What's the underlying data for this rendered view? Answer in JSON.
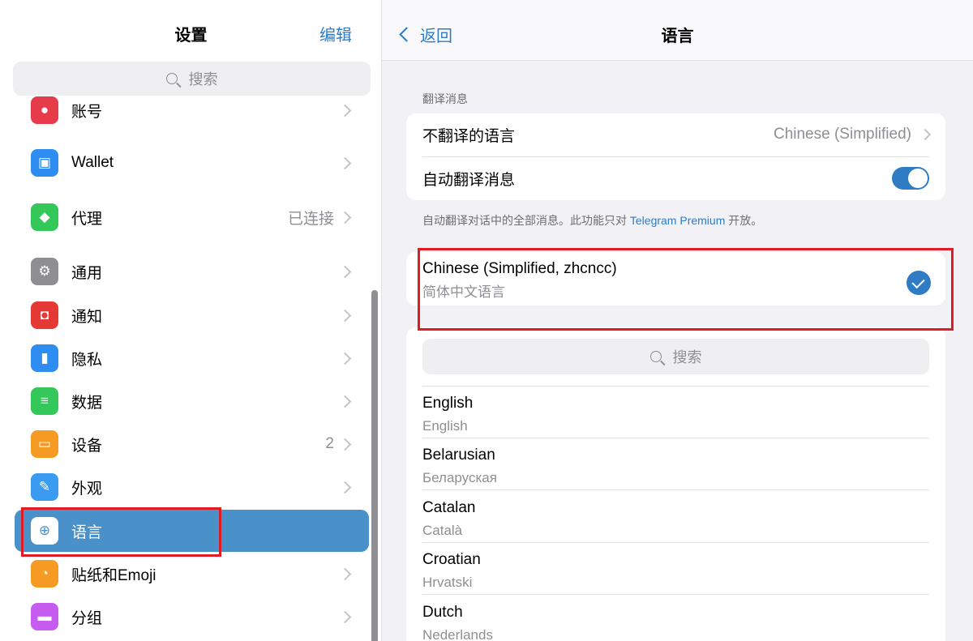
{
  "sidebar": {
    "title": "设置",
    "edit_label": "编辑",
    "search_placeholder": "搜索",
    "items": [
      {
        "label": "账号",
        "value": "",
        "icon": "account-icon",
        "color": "#e53b4a"
      },
      {
        "label": "Wallet",
        "value": "",
        "icon": "wallet-icon",
        "color": "#2f8cf0"
      },
      {
        "label": "代理",
        "value": "已连接",
        "icon": "shield-icon",
        "color": "#34c759"
      },
      {
        "label": "通用",
        "value": "",
        "icon": "gear-icon",
        "color": "#8e8e93"
      },
      {
        "label": "通知",
        "value": "",
        "icon": "notification-icon",
        "color": "#e53935"
      },
      {
        "label": "隐私",
        "value": "",
        "icon": "lock-icon",
        "color": "#2f8cf0"
      },
      {
        "label": "数据",
        "value": "",
        "icon": "database-icon",
        "color": "#34c759"
      },
      {
        "label": "设备",
        "value": "2",
        "icon": "laptop-icon",
        "color": "#f59a23"
      },
      {
        "label": "外观",
        "value": "",
        "icon": "brush-icon",
        "color": "#3b9bf0"
      },
      {
        "label": "语言",
        "value": "",
        "icon": "globe-icon",
        "color": "#4a90c9",
        "selected": true
      },
      {
        "label": "贴纸和Emoji",
        "value": "",
        "icon": "sticker-icon",
        "color": "#f59a23"
      },
      {
        "label": "分组",
        "value": "",
        "icon": "folder-icon",
        "color": "#c75cf0"
      }
    ]
  },
  "detail": {
    "back_label": "返回",
    "title": "语言",
    "translate_section_header": "翻译消息",
    "do_not_translate_label": "不翻译的语言",
    "do_not_translate_value": "Chinese (Simplified)",
    "auto_translate_label": "自动翻译消息",
    "auto_translate_on": true,
    "footnote_text": "自动翻译对话中的全部消息。此功能只对 ",
    "footnote_link": "Telegram Premium",
    "footnote_suffix": " 开放。",
    "current_language": {
      "name": "Chinese (Simplified, zhcncc)",
      "native": "简体中文语言",
      "checked": true
    },
    "search_placeholder": "搜索",
    "languages": [
      {
        "name": "English",
        "native": "English"
      },
      {
        "name": "Belarusian",
        "native": "Беларуская"
      },
      {
        "name": "Catalan",
        "native": "Català"
      },
      {
        "name": "Croatian",
        "native": "Hrvatski"
      },
      {
        "name": "Dutch",
        "native": "Nederlands"
      }
    ]
  },
  "colors": {
    "accent": "#2f7bc4",
    "selected_row": "#4a90c9",
    "highlight_box": "#e01b24"
  }
}
